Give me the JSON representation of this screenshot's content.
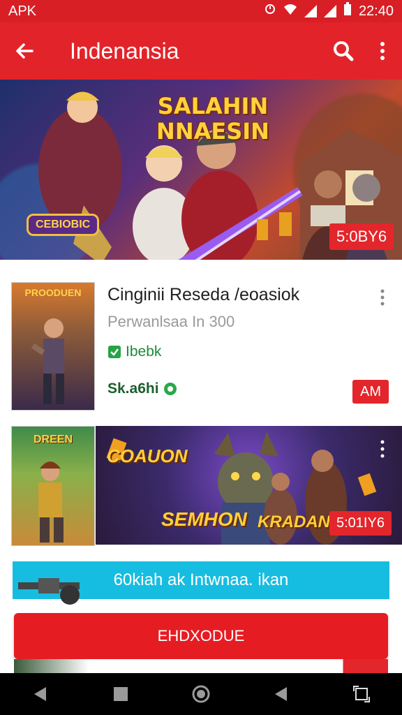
{
  "status_bar": {
    "left_label": "APK",
    "time": "22:40"
  },
  "app_bar": {
    "title": "Indenansia"
  },
  "hero": {
    "title_line1": "SALAHIN",
    "title_line2": "NNAESIN",
    "logo_text": "CEBIOBIC",
    "badge": "5:0BY6"
  },
  "app_card": {
    "name": "Cinginii Reseda /eoasiok",
    "subtitle": "Perwanlsaa In 300",
    "tag": "Ibebk",
    "price": "Sk.a6hi",
    "action": "AM",
    "thumb_title": "PROODUEN"
  },
  "row2": {
    "left_title": "DREEN",
    "banner_title_1": "COAUON",
    "banner_title_2": "SEMHON",
    "banner_title_3": "KRADAN",
    "badge": "5:01IY6"
  },
  "promo": {
    "text": "60kiah ak Intwnaa. ikan"
  },
  "cta": {
    "label": "EHDXODUE"
  },
  "colors": {
    "brand_red": "#e2242a",
    "accent_blue": "#17bde0",
    "nav_black": "#000000"
  }
}
